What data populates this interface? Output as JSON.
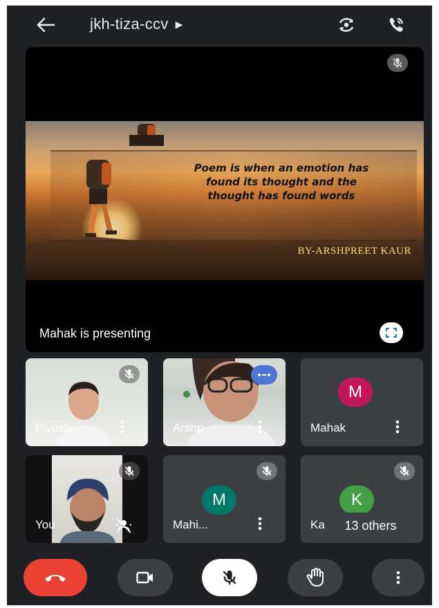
{
  "header": {
    "meeting_code": "jkh-tiza-ccv",
    "caret": "▶"
  },
  "presentation": {
    "slide_quote": "Poem is when an emotion has found its thought and the thought has found words",
    "slide_author": "BY-ARSHPREET KAUR",
    "status_text": "Mahak is presenting"
  },
  "participants": [
    {
      "name": "Piyush",
      "muted": true,
      "video": true
    },
    {
      "name": "Arshp...",
      "muted": false,
      "speaking": true,
      "video": true
    },
    {
      "name": "Mahak",
      "avatar_letter": "M",
      "avatar_color": "#c2185b",
      "video": false
    },
    {
      "name": "You",
      "muted": true,
      "video": true
    },
    {
      "name": "Mahi...",
      "avatar_letter": "M",
      "avatar_color": "#00796b",
      "muted": true,
      "video": false
    },
    {
      "name": "Ka",
      "avatar_letter": "K",
      "avatar_color": "#43a047",
      "muted": true,
      "video": false
    }
  ],
  "others_label": "13 others",
  "colors": {
    "end_call": "#ea4335",
    "background": "#202124",
    "tile": "#3c4043"
  },
  "icons": {
    "back": "arrow-left-icon",
    "switch_camera": "switch-camera-icon",
    "audio_output": "phone-speaker-icon",
    "fullscreen": "fullscreen-icon",
    "mic_off": "mic-off-icon",
    "more": "more-vert-icon",
    "end_call": "end-call-icon",
    "camera": "videocam-icon",
    "raise_hand": "raise-hand-icon"
  }
}
